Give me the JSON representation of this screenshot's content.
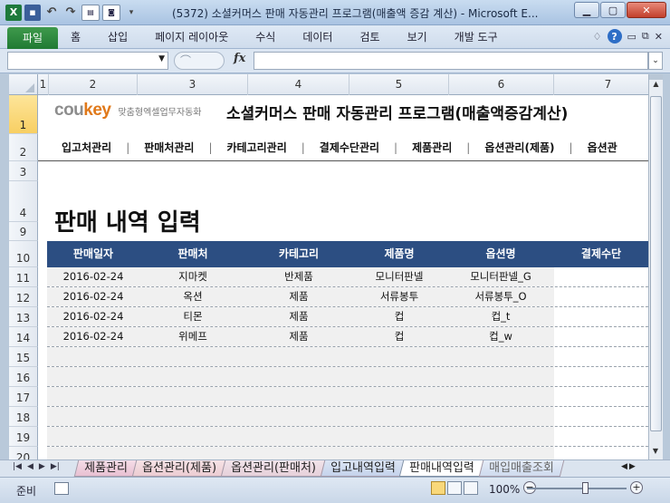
{
  "window": {
    "title": "(5372) 소셜커머스 판매 자동관리 프로그램(매출액 증감 계산) - Microsoft E...",
    "min": "▁",
    "max": "▢",
    "close": "✕"
  },
  "ribbon": {
    "file": "파일",
    "tabs": [
      "홈",
      "삽입",
      "페이지 레이아웃",
      "수식",
      "데이터",
      "검토",
      "보기",
      "개발 도구"
    ]
  },
  "formula_bar": {
    "name_box": "",
    "fx": "fx",
    "value": ""
  },
  "columns": [
    "1",
    "2",
    "3",
    "4",
    "5",
    "6",
    "7"
  ],
  "rows": [
    "1",
    "2",
    "3",
    "4",
    "9",
    "10",
    "11",
    "12",
    "13",
    "14",
    "15",
    "16",
    "17",
    "18",
    "19",
    "20"
  ],
  "sheet": {
    "logo_cou": "cou",
    "logo_key": "key",
    "tagline": "맞춤형엑셀업무자동화",
    "title": "소셜커머스 판매 자동관리 프로그램(매출액증감계산)",
    "menu": [
      "입고처관리",
      "판매처관리",
      "카테고리관리",
      "결제수단관리",
      "제품관리",
      "옵션관리(제품)",
      "옵션관"
    ],
    "page_title": "판매 내역 입력",
    "table": {
      "headers": [
        "판매일자",
        "판매처",
        "카테고리",
        "제품명",
        "옵션명",
        "결제수단"
      ],
      "rows": [
        [
          "2016-02-24",
          "지마켓",
          "반제품",
          "모니터판넬",
          "모니터판넬_G",
          ""
        ],
        [
          "2016-02-24",
          "옥션",
          "제품",
          "서류봉투",
          "서류봉투_O",
          ""
        ],
        [
          "2016-02-24",
          "티몬",
          "제품",
          "컵",
          "컵_t",
          ""
        ],
        [
          "2016-02-24",
          "위메프",
          "제품",
          "컵",
          "컵_w",
          ""
        ]
      ]
    }
  },
  "sheet_tabs": [
    "제품관리",
    "옵션관리(제품)",
    "옵션관리(판매처)",
    "입고내역입력",
    "판매내역입력",
    "매입매출조회"
  ],
  "active_tab_index": 4,
  "status": {
    "ready": "준비",
    "zoom": "100%"
  }
}
